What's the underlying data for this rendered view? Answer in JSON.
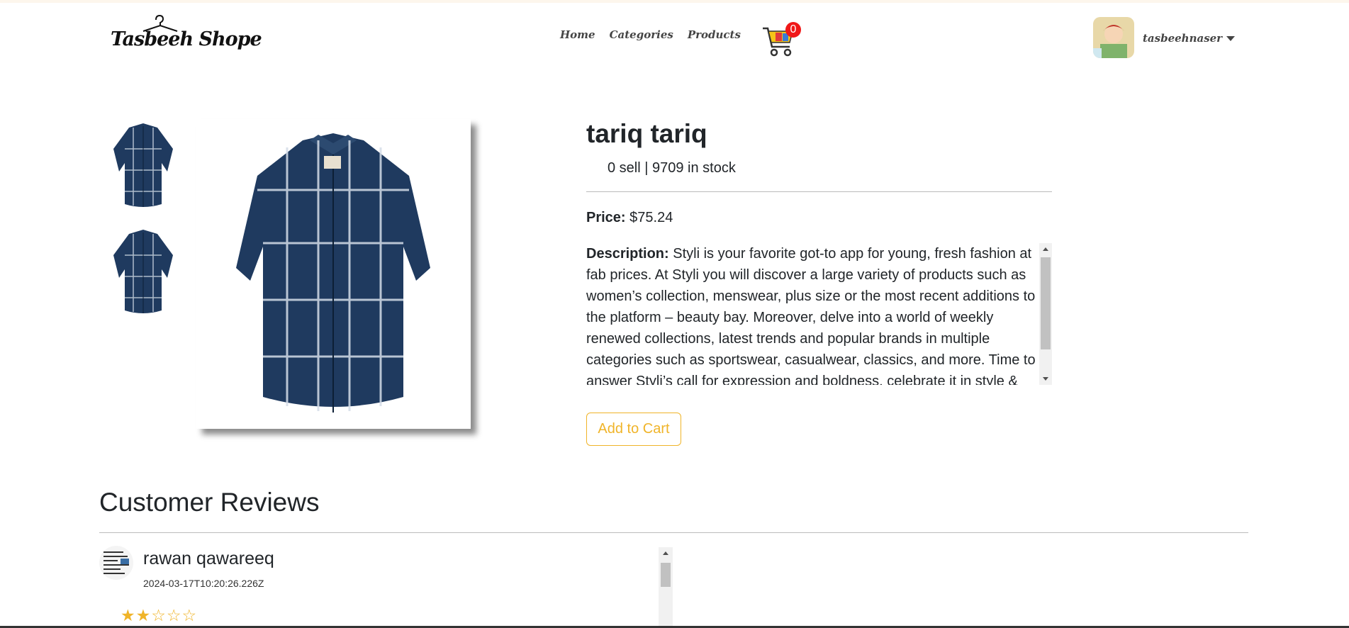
{
  "brand": {
    "name": "Tasbeeh Shope"
  },
  "nav": {
    "items": [
      "Home",
      "Categories",
      "Products"
    ]
  },
  "cart": {
    "count": "0"
  },
  "user": {
    "name": "tasbeehnaser"
  },
  "product": {
    "title": "tariq tariq",
    "stock_line": "0 sell | 9709 in stock",
    "price_label": "Price:",
    "price_value": "$75.24",
    "description_label": "Description:",
    "description": "Styli is your favorite got-to app for young, fresh fashion at fab prices. At Styli you will discover a large variety of products such as women’s collection, menswear, plus size or the most recent additions to the platform – beauty bay. Moreover, delve into a world of weekly renewed collections, latest trends and popular brands in multiple categories such as sportswear, casualwear, classics, and more. Time to answer Styli’s call for expression and boldness, celebrate it in style & make your own fashion statement.",
    "add_to_cart_label": "Add to Cart"
  },
  "reviews": {
    "heading": "Customer Reviews",
    "items": [
      {
        "name": "rawan qawareeq",
        "date": "2024-03-17T10:20:26.226Z",
        "rating": 2,
        "max_rating": 5
      }
    ]
  },
  "colors": {
    "accent": "#f0b429",
    "badge": "#f01818",
    "shirt": "#1f3a5f"
  }
}
